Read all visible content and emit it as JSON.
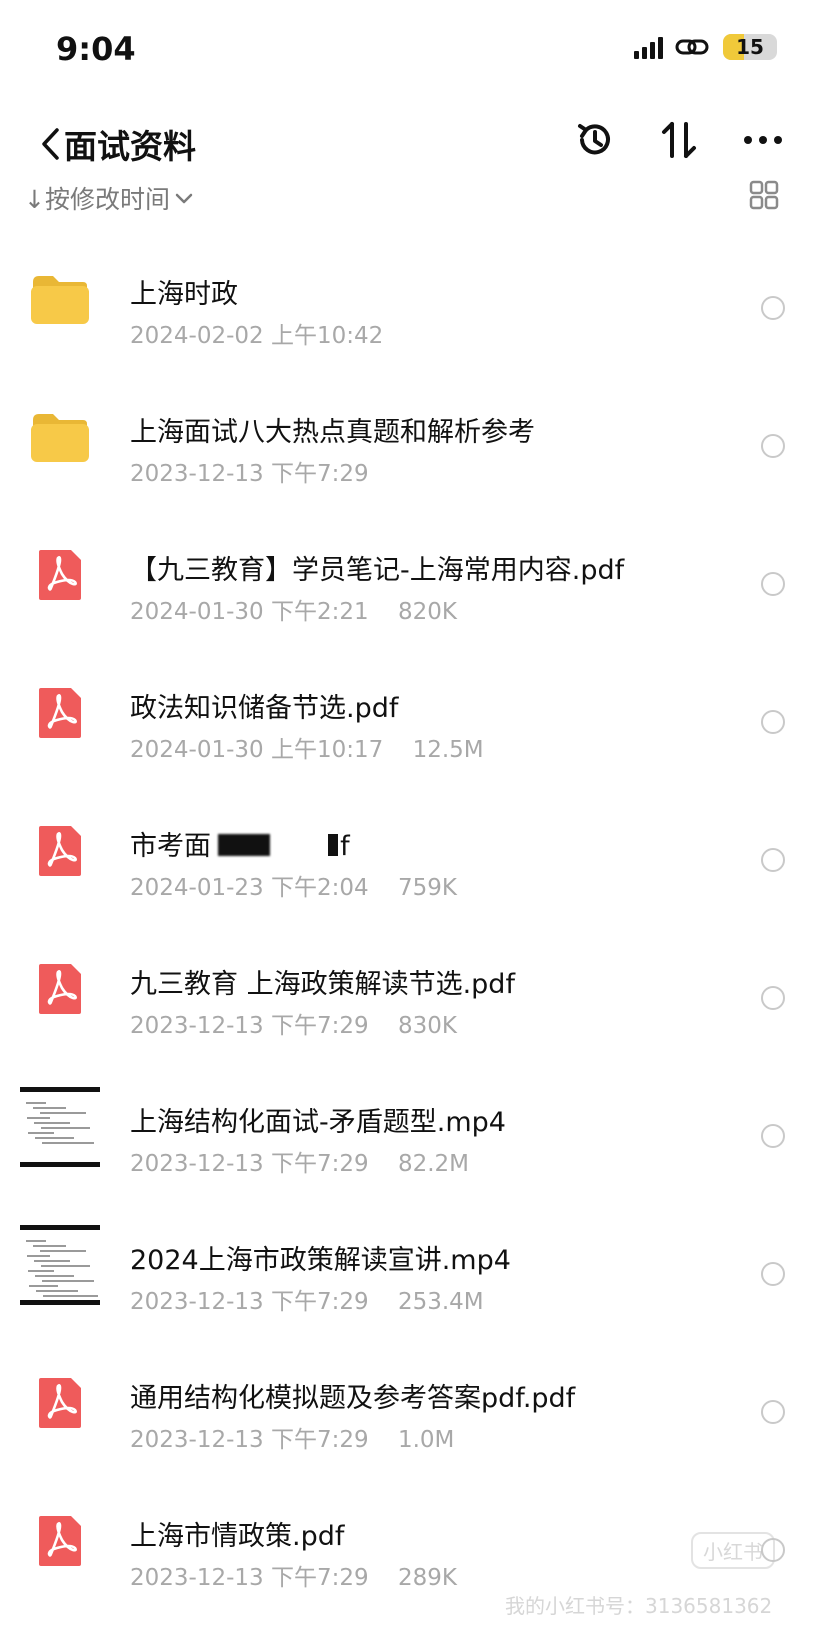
{
  "status_bar": {
    "time": "9:04",
    "battery": "15",
    "battery_level": 0.15
  },
  "nav": {
    "title": "面试资料"
  },
  "sort": {
    "label": "↓按修改时间"
  },
  "files": [
    {
      "name": "上海时政",
      "date": "2024-02-02 上午10:42",
      "size": "",
      "type": "folder-icon"
    },
    {
      "name": "上海面试八大热点真题和解析参考",
      "date": "2023-12-13 下午7:29",
      "size": "",
      "type": "folder-icon"
    },
    {
      "name": "【九三教育】学员笔记-上海常用内容.pdf",
      "date": "2024-01-30 下午2:21",
      "size": "820K",
      "type": "pdf-icon"
    },
    {
      "name": "政法知识储备节选.pdf",
      "date": "2024-01-30 上午10:17",
      "size": "12.5M",
      "type": "pdf-icon"
    },
    {
      "name": "市考面",
      "date": "2024-01-23 下午2:04",
      "size": "759K",
      "type": "pdf-icon",
      "suffix": "df"
    },
    {
      "name": "九三教育 上海政策解读节选.pdf",
      "date": "2023-12-13 下午7:29",
      "size": "830K",
      "type": "pdf-icon"
    },
    {
      "name": "上海结构化面试-矛盾题型.mp4",
      "date": "2023-12-13 下午7:29",
      "size": "82.2M",
      "type": "video-thumbnail"
    },
    {
      "name": "2024上海市政策解读宣讲.mp4",
      "date": "2023-12-13 下午7:29",
      "size": "253.4M",
      "type": "video-thumbnail"
    },
    {
      "name": "通用结构化模拟题及参考答案pdf.pdf",
      "date": "2023-12-13 下午7:29",
      "size": "1.0M",
      "type": "pdf-icon"
    },
    {
      "name": "上海市情政策.pdf",
      "date": "2023-12-13 下午7:29",
      "size": "289K",
      "type": "pdf-icon"
    }
  ],
  "watermark": {
    "text": "我的小红书号：3136581362",
    "logo": "小红书"
  },
  "colors": {
    "folder": "#f7c948",
    "pdf": "#ef5b5b",
    "meta_text": "#a8a8a8"
  }
}
